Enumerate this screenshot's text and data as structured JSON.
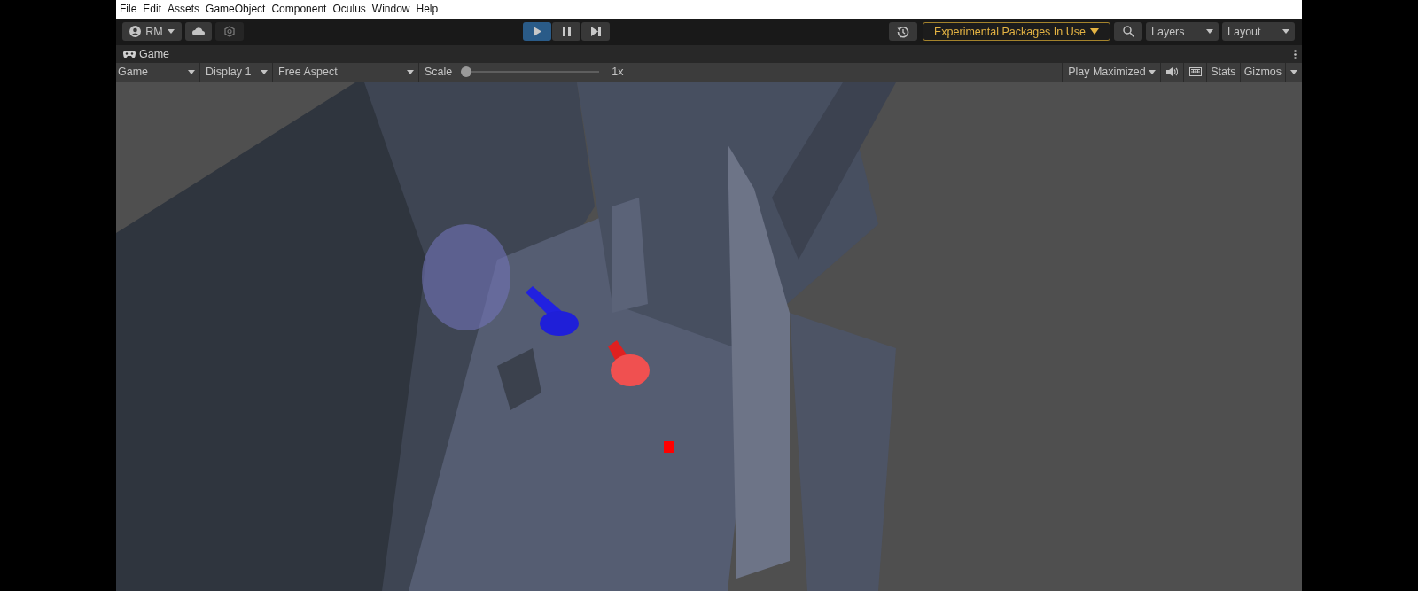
{
  "menu_bar": {
    "items": [
      "File",
      "Edit",
      "Assets",
      "GameObject",
      "Component",
      "Oculus",
      "Window",
      "Help"
    ]
  },
  "toolbar": {
    "account": {
      "label": "RM"
    },
    "play_controls": [
      {
        "kind": "play",
        "selected": true
      },
      {
        "kind": "pause",
        "selected": false
      },
      {
        "kind": "step",
        "selected": false
      }
    ],
    "packages_warning": {
      "label": "Experimental Packages In Use"
    },
    "dropdowns": [
      "Layers",
      "Layout"
    ]
  },
  "tab": {
    "label": "Game"
  },
  "game_toolbar": {
    "view_dropdown": "Game",
    "display_dropdown": "Display 1",
    "aspect_dropdown": "Free Aspect",
    "scale": {
      "label": "Scale",
      "level": 0,
      "reading": "1x"
    },
    "play_mode_dropdown": "Play Maximized",
    "stats": "Stats",
    "gizmos": "Gizmos"
  }
}
